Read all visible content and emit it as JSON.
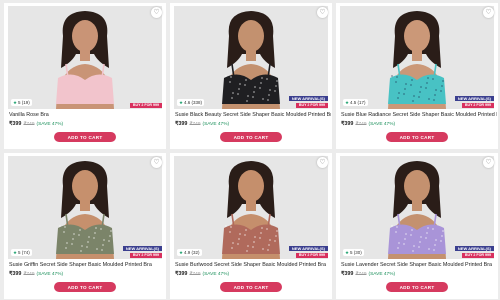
{
  "product_grid": {
    "products": [
      {
        "name": "Vanilla Rose Bra",
        "rating": "5 (19)",
        "price": "₹399",
        "mrp": "₹749",
        "save": "(SAVE 47%)",
        "badge_new": "",
        "badge_offer": "BUY 2 FOR 999",
        "add_to_cart": "ADD TO CART",
        "garment_color": "#f2c4cc",
        "pattern": "none",
        "wishlist_icon": "heart-outline-icon"
      },
      {
        "name": "Susie Black Beauty Secret Side Shaper Basic Moulded Printed Bra",
        "rating": "4.6 (338)",
        "price": "₹399",
        "mrp": "₹749",
        "save": "(SAVE 47%)",
        "badge_new": "NEW ARRIVAL(S)",
        "badge_offer": "BUY 2 FOR 999",
        "add_to_cart": "ADD TO CART",
        "garment_color": "#1f1f22",
        "pattern": "dots-light",
        "wishlist_icon": "heart-outline-icon"
      },
      {
        "name": "Susie Blue Radiance Secret Side Shaper Basic Moulded Printed Bra",
        "rating": "4.5 (17)",
        "price": "₹399",
        "mrp": "₹749",
        "save": "(SAVE 47%)",
        "badge_new": "NEW ARRIVAL(S)",
        "badge_offer": "BUY 2 FOR 999",
        "add_to_cart": "ADD TO CART",
        "garment_color": "#48c2c4",
        "pattern": "dots-dark",
        "wishlist_icon": "heart-outline-icon"
      },
      {
        "name": "Susie Griffin Secret Side Shaper Basic Moulded Printed Bra",
        "rating": "5 (74)",
        "price": "₹399",
        "mrp": "₹749",
        "save": "(SAVE 47%)",
        "badge_new": "NEW ARRIVAL(S)",
        "badge_offer": "BUY 2 FOR 999",
        "add_to_cart": "ADD TO CART",
        "garment_color": "#7b8469",
        "pattern": "dots-light",
        "wishlist_icon": "heart-outline-icon"
      },
      {
        "name": "Susie Burlwood Secret Side Shaper Basic Moulded Printed Bra",
        "rating": "4.9 (32)",
        "price": "₹399",
        "mrp": "₹749",
        "save": "(SAVE 47%)",
        "badge_new": "NEW ARRIVAL(S)",
        "badge_offer": "BUY 2 FOR 999",
        "add_to_cart": "ADD TO CART",
        "garment_color": "#b06a5c",
        "pattern": "dots-light",
        "wishlist_icon": "heart-outline-icon"
      },
      {
        "name": "Susie Lavender Secret Side Shaper Basic Moulded Printed Bra",
        "rating": "5 (30)",
        "price": "₹399",
        "mrp": "₹749",
        "save": "(SAVE 47%)",
        "badge_new": "NEW ARRIVAL(S)",
        "badge_offer": "BUY 2 FOR 999",
        "add_to_cart": "ADD TO CART",
        "garment_color": "#a994d8",
        "pattern": "dots-light",
        "wishlist_icon": "heart-outline-icon"
      }
    ]
  },
  "colors": {
    "accent": "#d63a5f",
    "new_badge": "#3b3f8f",
    "save_text": "#1a8f5a",
    "rating_star": "#1aa06d"
  }
}
